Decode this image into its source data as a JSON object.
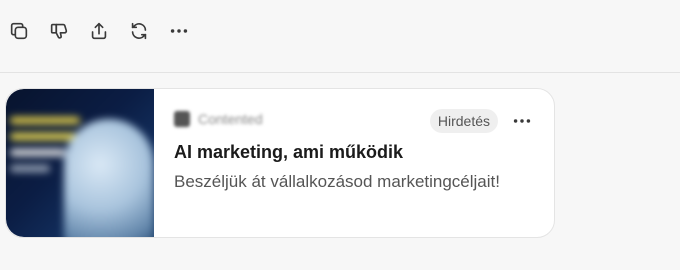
{
  "toolbar": {
    "buttons": [
      {
        "name": "copy-button",
        "icon": "copy-icon"
      },
      {
        "name": "dislike-button",
        "icon": "thumbs-down-icon"
      },
      {
        "name": "share-button",
        "icon": "share-icon"
      },
      {
        "name": "regenerate-button",
        "icon": "refresh-icon"
      },
      {
        "name": "more-options-button",
        "icon": "more-horizontal-icon"
      }
    ]
  },
  "ad": {
    "advertiser": "Contented",
    "badge": "Hirdetés",
    "title": "AI marketing, ami működik",
    "description": "Beszéljük át vállalkozásod marketingcéljait!",
    "more_icon": "more-horizontal-icon"
  },
  "colors": {
    "background": "#f7f7f7",
    "card": "#ffffff",
    "icon": "#3a3a3a",
    "badge_bg": "#efefef"
  }
}
